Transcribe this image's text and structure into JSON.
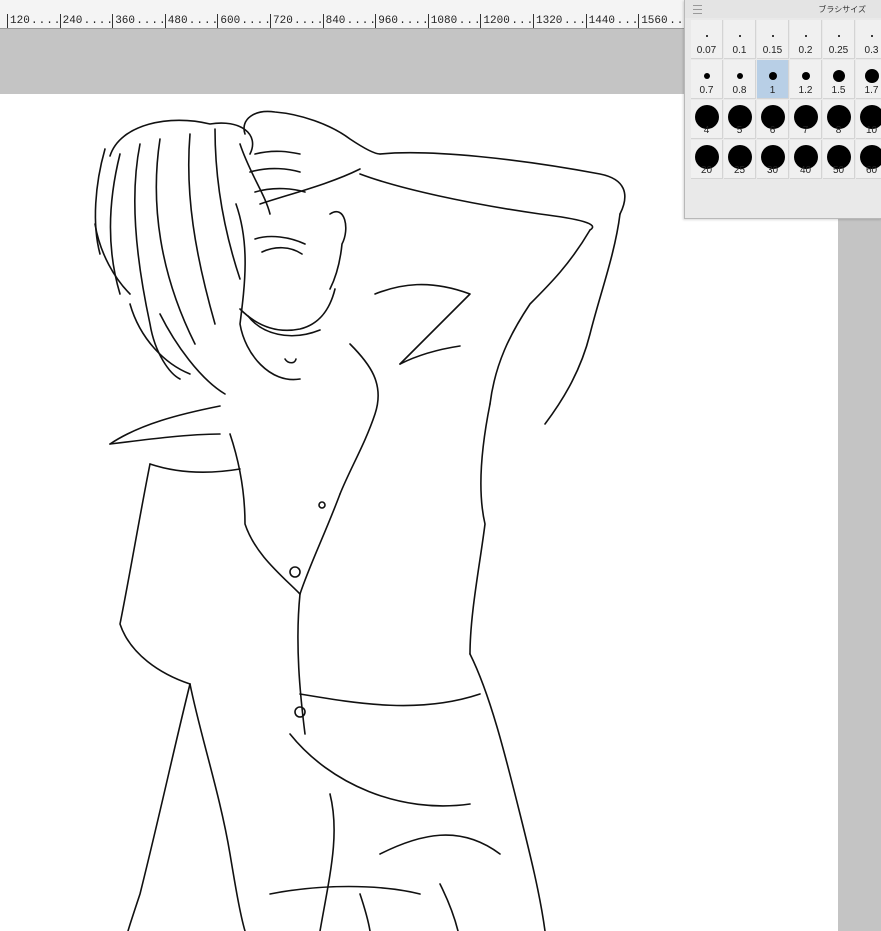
{
  "ruler": {
    "labels": [
      "120",
      "240",
      "360",
      "480",
      "600",
      "720",
      "840",
      "960",
      "1080",
      "1200",
      "1320",
      "1440",
      "1560"
    ]
  },
  "brush_panel": {
    "title": "ブラシサイズ",
    "menu_icon": "hamburger-icon",
    "sizes": [
      [
        "0.07",
        "0.1",
        "0.15",
        "0.2",
        "0.25",
        "0.3"
      ],
      [
        "0.7",
        "0.8",
        "1",
        "1.2",
        "1.5",
        "1.7"
      ],
      [
        "4",
        "5",
        "6",
        "7",
        "8",
        "10"
      ],
      [
        "20",
        "25",
        "30",
        "40",
        "50",
        "60"
      ]
    ],
    "selected": "1",
    "selected_color": "#b8cfe6"
  },
  "canvas": {
    "paper_color": "#ffffff",
    "background_color": "#c4c4c4",
    "content": "line-art-sketch"
  }
}
